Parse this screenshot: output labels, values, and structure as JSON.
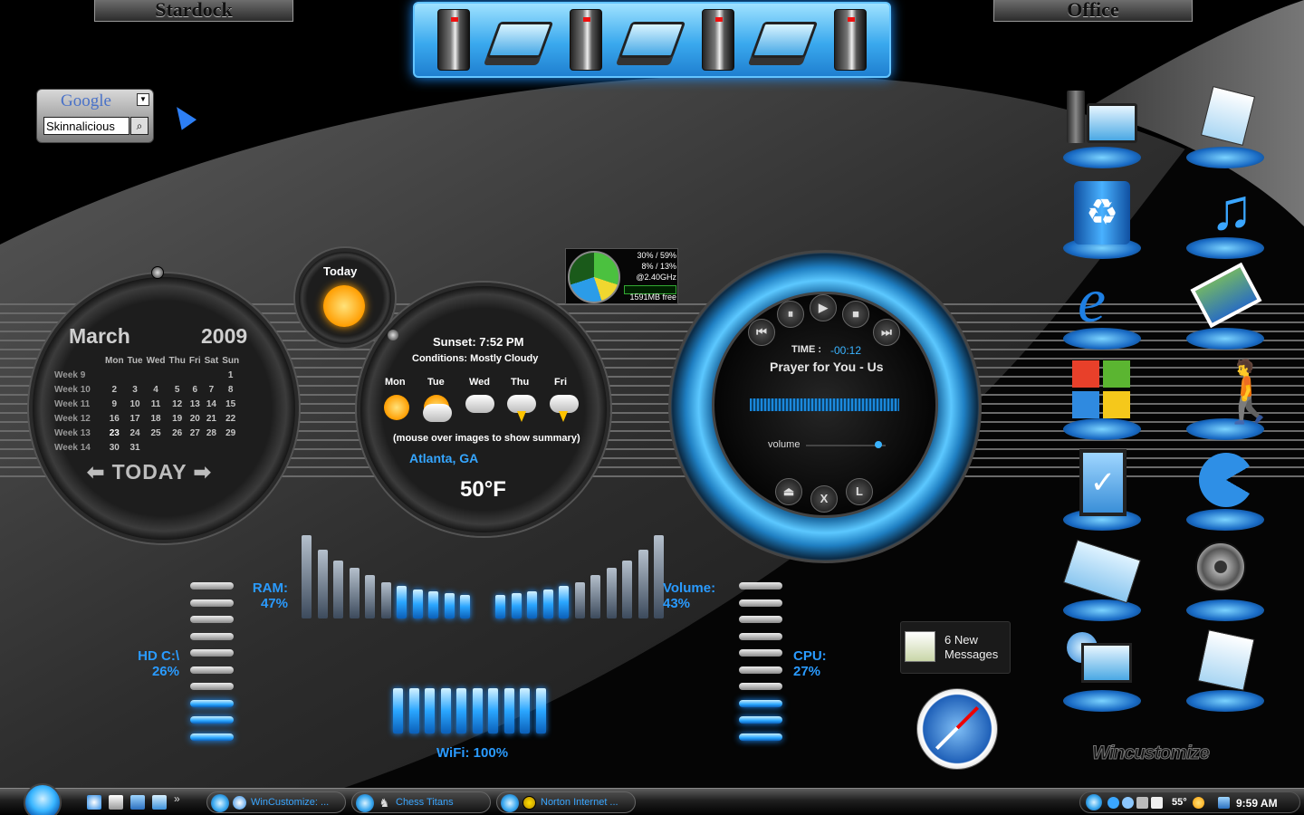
{
  "docks": {
    "left_label": "Stardock",
    "right_label": "Office"
  },
  "google": {
    "logo": "Google",
    "search_value": "Skinnalicious"
  },
  "calendar": {
    "month": "March",
    "year": "2009",
    "days": [
      "Mon",
      "Tue",
      "Wed",
      "Thu",
      "Fri",
      "Sat",
      "Sun"
    ],
    "weeks": [
      {
        "label": "Week 9",
        "cells": [
          "",
          "",
          "",
          "",
          "",
          "",
          "1"
        ]
      },
      {
        "label": "Week 10",
        "cells": [
          "2",
          "3",
          "4",
          "5",
          "6",
          "7",
          "8"
        ]
      },
      {
        "label": "Week 11",
        "cells": [
          "9",
          "10",
          "11",
          "12",
          "13",
          "14",
          "15"
        ]
      },
      {
        "label": "Week 12",
        "cells": [
          "16",
          "17",
          "18",
          "19",
          "20",
          "21",
          "22"
        ]
      },
      {
        "label": "Week 13",
        "cells": [
          "23",
          "24",
          "25",
          "26",
          "27",
          "28",
          "29"
        ]
      },
      {
        "label": "Week 14",
        "cells": [
          "30",
          "31",
          "",
          "",
          "",
          "",
          ""
        ]
      }
    ],
    "today_button": "TODAY"
  },
  "today": {
    "label": "Today"
  },
  "weather": {
    "sunset": "Sunset: 7:52 PM",
    "conditions": "Conditions: Mostly Cloudy",
    "forecast": [
      "Mon",
      "Tue",
      "Wed",
      "Thu",
      "Fri"
    ],
    "hint": "(mouse over images to show summary)",
    "location": "Atlanta, GA",
    "temp": "50°F"
  },
  "meter": {
    "line1": "30% /   59%",
    "line2": "8% /   13%",
    "line3": "@2.40GHz",
    "line4": "1591MB free"
  },
  "player": {
    "time_label": "TIME :",
    "time": "-00:12",
    "title": "Prayer for You - Us",
    "volume_label": "volume",
    "buttons": {
      "close": "X",
      "l": "L"
    }
  },
  "stats": {
    "ram_label": "RAM:",
    "ram_value": "47%",
    "volume_label": "Volume:",
    "volume_value": "43%",
    "hd_label": "HD C:\\",
    "hd_value": "26%",
    "cpu_label": "CPU:",
    "cpu_value": "27%",
    "wifi_label": "WiFi: 100%",
    "ram": 0.47,
    "volume": 0.43,
    "hd": 0.26,
    "cpu": 0.27,
    "wifi": 1.0
  },
  "messages": {
    "line1": "6 New",
    "line2": "Messages"
  },
  "watermark": "Wincustomize",
  "taskbar": {
    "tasks": [
      {
        "label": "WinCustomize: ..."
      },
      {
        "label": "Chess Titans"
      },
      {
        "label": "Norton Internet ..."
      }
    ],
    "temp": "55°",
    "clock": "9:59 AM"
  },
  "colors": {
    "accent": "#2a9bff",
    "glow": "#5cc8ff",
    "background": "#000000"
  }
}
